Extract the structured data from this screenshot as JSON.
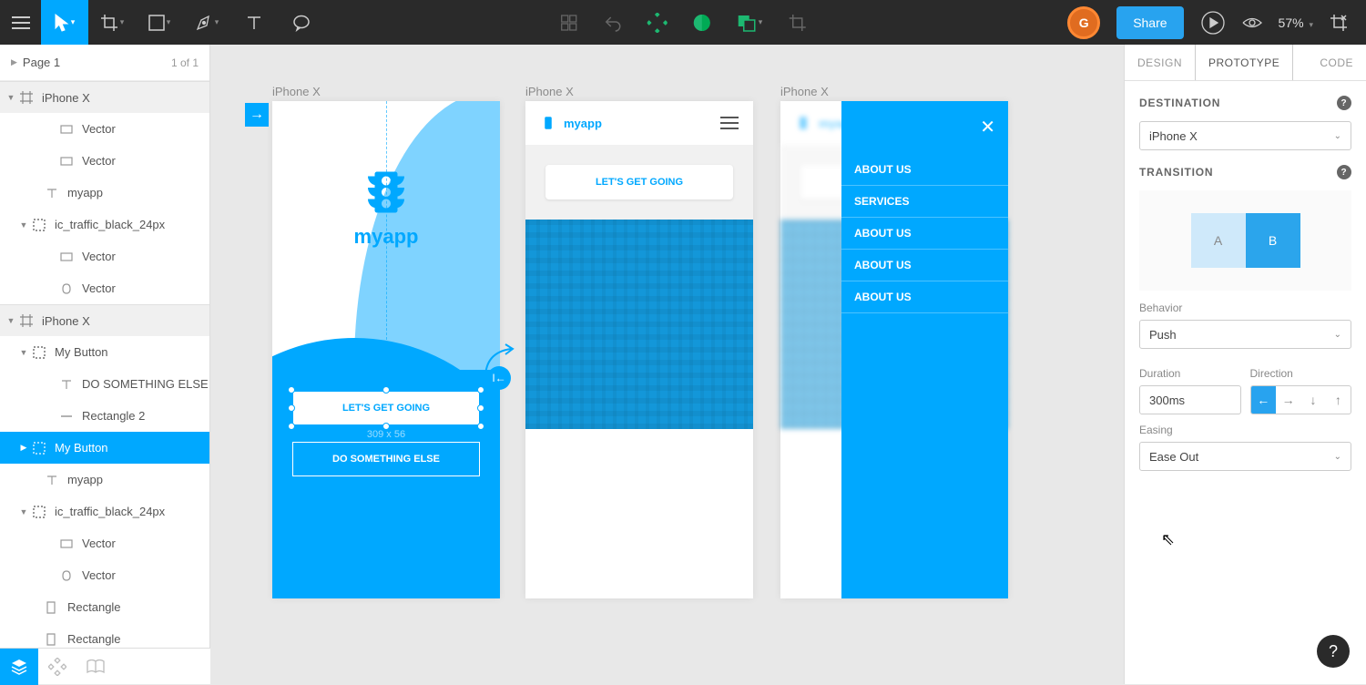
{
  "topbar": {
    "avatar_letter": "G",
    "share": "Share",
    "zoom": "57%"
  },
  "page": {
    "name": "Page 1",
    "count": "1 of 1"
  },
  "layers": [
    {
      "depth": "ind1",
      "type": "header",
      "icon": "artboard",
      "text": "iPhone X",
      "tw": "▼"
    },
    {
      "depth": "ind3",
      "icon": "rect",
      "text": "Vector"
    },
    {
      "depth": "ind3",
      "icon": "rect",
      "text": "Vector"
    },
    {
      "depth": "ind4",
      "icon": "text",
      "text": "myapp"
    },
    {
      "depth": "ind2",
      "icon": "frame",
      "text": "ic_traffic_black_24px",
      "tw": "▼"
    },
    {
      "depth": "ind3",
      "icon": "rect",
      "text": "Vector"
    },
    {
      "depth": "ind3",
      "icon": "blob",
      "text": "Vector"
    },
    {
      "depth": "ind1",
      "type": "header",
      "icon": "artboard",
      "text": "iPhone X",
      "tw": "▼"
    },
    {
      "depth": "ind2",
      "icon": "frame",
      "text": "My Button",
      "tw": "▼"
    },
    {
      "depth": "ind3",
      "icon": "text",
      "text": "DO SOMETHING ELSE"
    },
    {
      "depth": "ind3",
      "icon": "line",
      "text": "Rectangle 2"
    },
    {
      "depth": "ind2",
      "type": "sel",
      "icon": "frame",
      "text": "My Button",
      "tw": "▶"
    },
    {
      "depth": "ind4",
      "icon": "text",
      "text": "myapp"
    },
    {
      "depth": "ind2",
      "icon": "frame",
      "text": "ic_traffic_black_24px",
      "tw": "▼"
    },
    {
      "depth": "ind3",
      "icon": "rect",
      "text": "Vector"
    },
    {
      "depth": "ind3",
      "icon": "blob",
      "text": "Vector"
    },
    {
      "depth": "ind4",
      "icon": "shape",
      "text": "Rectangle"
    },
    {
      "depth": "ind4",
      "icon": "shape",
      "text": "Rectangle"
    }
  ],
  "artboards": {
    "label": "iPhone X"
  },
  "ab1": {
    "brand": "myapp",
    "btn1": "LET'S GET GOING",
    "dim": "309 x 56",
    "btn2": "DO SOMETHING ELSE"
  },
  "ab2": {
    "brand": "myapp",
    "cta": "LET'S GET GOING"
  },
  "ab3": {
    "items": [
      "ABOUT US",
      "SERVICES",
      "ABOUT US",
      "ABOUT US",
      "ABOUT US"
    ]
  },
  "panel": {
    "tabs": {
      "design": "DESIGN",
      "prototype": "PROTOTYPE",
      "code": "CODE"
    },
    "destination": {
      "label": "DESTINATION",
      "value": "iPhone X"
    },
    "transition": {
      "label": "TRANSITION",
      "A": "A",
      "B": "B"
    },
    "behavior": {
      "label": "Behavior",
      "value": "Push"
    },
    "duration": {
      "label": "Duration",
      "value": "300ms"
    },
    "direction": {
      "label": "Direction"
    },
    "easing": {
      "label": "Easing",
      "value": "Ease Out"
    }
  }
}
